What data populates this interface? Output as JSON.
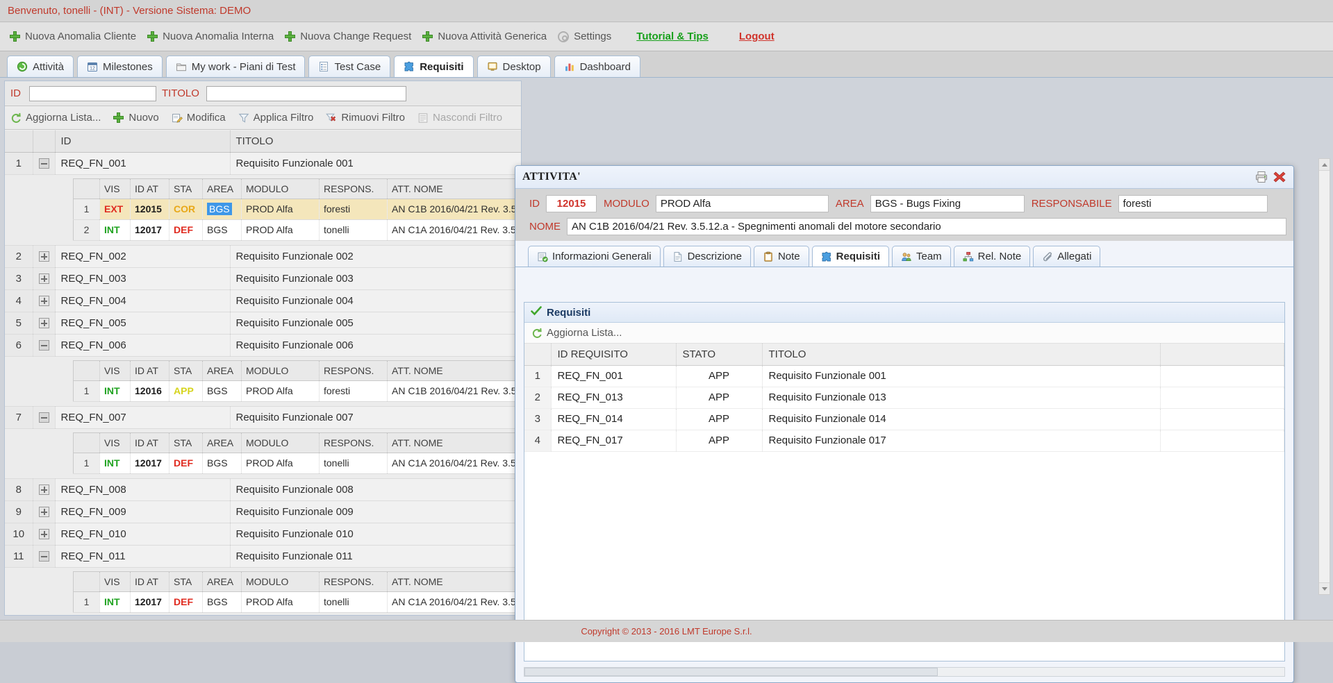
{
  "welcome": {
    "text": "Benvenuto, tonelli - (INT) - Versione Sistema: DEMO"
  },
  "action_bar": {
    "items": [
      {
        "label": "Nuova Anomalia Cliente",
        "icon": "plus-icon"
      },
      {
        "label": "Nuova Anomalia Interna",
        "icon": "plus-icon"
      },
      {
        "label": "Nuova Change Request",
        "icon": "plus-icon"
      },
      {
        "label": "Nuova Attività Generica",
        "icon": "plus-icon"
      },
      {
        "label": "Settings",
        "icon": "gear-icon"
      }
    ],
    "tutorial_label": "Tutorial & Tips",
    "logout_label": "Logout"
  },
  "main_tabs": [
    {
      "label": "Attività",
      "icon": "activity-icon",
      "active": false
    },
    {
      "label": "Milestones",
      "icon": "calendar-icon",
      "active": false
    },
    {
      "label": "My work - Piani di Test",
      "icon": "folder-icon",
      "active": false
    },
    {
      "label": "Test Case",
      "icon": "list-icon",
      "active": false
    },
    {
      "label": "Requisiti",
      "icon": "puzzle-icon",
      "active": true
    },
    {
      "label": "Desktop",
      "icon": "desktop-icon",
      "active": false
    },
    {
      "label": "Dashboard",
      "icon": "chart-icon",
      "active": false
    }
  ],
  "filter": {
    "id_label": "ID",
    "id_value": "",
    "id_placeholder": "",
    "titolo_label": "TITOLO",
    "titolo_value": "",
    "titolo_placeholder": ""
  },
  "commands": [
    {
      "label": "Aggiorna Lista...",
      "icon": "refresh-icon",
      "disabled": false
    },
    {
      "label": "Nuovo",
      "icon": "plus-icon",
      "disabled": false
    },
    {
      "label": "Modifica",
      "icon": "edit-icon",
      "disabled": false
    },
    {
      "label": "Applica Filtro",
      "icon": "funnel-icon",
      "disabled": false
    },
    {
      "label": "Rimuovi Filtro",
      "icon": "funnel-remove-icon",
      "disabled": false
    },
    {
      "label": "Nascondi Filtro",
      "icon": "hide-filter-icon",
      "disabled": true
    }
  ],
  "master_grid": {
    "headers": {
      "num": "",
      "exp": "",
      "id": "ID",
      "titolo": "TITOLO"
    },
    "sub_headers": [
      "",
      "VIS",
      "ID AT",
      "STA",
      "AREA",
      "MODULO",
      "RESPONS.",
      "ATT. NOME"
    ],
    "rows": [
      {
        "num": "1",
        "expanded": true,
        "id": "REQ_FN_001",
        "titolo": "Requisito Funzionale 001",
        "sub_rows": [
          {
            "n": "1",
            "vis": "EXT",
            "vis_kind": "ext",
            "id_at": "12015",
            "sta": "COR",
            "sta_kind": "cor",
            "area": "BGS",
            "area_highlight": true,
            "modulo": "PROD Alfa",
            "respons": "foresti",
            "att_nome": "AN C1B 2016/04/21 Rev. 3.5",
            "selected": true
          },
          {
            "n": "2",
            "vis": "INT",
            "vis_kind": "int",
            "id_at": "12017",
            "sta": "DEF",
            "sta_kind": "def",
            "area": "BGS",
            "area_highlight": false,
            "modulo": "PROD Alfa",
            "respons": "tonelli",
            "att_nome": "AN C1A 2016/04/21 Rev. 3.5",
            "selected": false
          }
        ]
      },
      {
        "num": "2",
        "expanded": false,
        "id": "REQ_FN_002",
        "titolo": "Requisito Funzionale 002",
        "sub_rows": []
      },
      {
        "num": "3",
        "expanded": false,
        "id": "REQ_FN_003",
        "titolo": "Requisito Funzionale 003",
        "sub_rows": []
      },
      {
        "num": "4",
        "expanded": false,
        "id": "REQ_FN_004",
        "titolo": "Requisito Funzionale 004",
        "sub_rows": []
      },
      {
        "num": "5",
        "expanded": false,
        "id": "REQ_FN_005",
        "titolo": "Requisito Funzionale 005",
        "sub_rows": []
      },
      {
        "num": "6",
        "expanded": true,
        "id": "REQ_FN_006",
        "titolo": "Requisito Funzionale 006",
        "sub_rows": [
          {
            "n": "1",
            "vis": "INT",
            "vis_kind": "int",
            "id_at": "12016",
            "sta": "APP",
            "sta_kind": "app",
            "area": "BGS",
            "area_highlight": false,
            "modulo": "PROD Alfa",
            "respons": "foresti",
            "att_nome": "AN C1B 2016/04/21 Rev. 3.5",
            "selected": false
          }
        ]
      },
      {
        "num": "7",
        "expanded": true,
        "id": "REQ_FN_007",
        "titolo": "Requisito Funzionale 007",
        "sub_rows": [
          {
            "n": "1",
            "vis": "INT",
            "vis_kind": "int",
            "id_at": "12017",
            "sta": "DEF",
            "sta_kind": "def",
            "area": "BGS",
            "area_highlight": false,
            "modulo": "PROD Alfa",
            "respons": "tonelli",
            "att_nome": "AN C1A 2016/04/21 Rev. 3.5",
            "selected": false
          }
        ]
      },
      {
        "num": "8",
        "expanded": false,
        "id": "REQ_FN_008",
        "titolo": "Requisito Funzionale 008",
        "sub_rows": []
      },
      {
        "num": "9",
        "expanded": false,
        "id": "REQ_FN_009",
        "titolo": "Requisito Funzionale 009",
        "sub_rows": []
      },
      {
        "num": "10",
        "expanded": false,
        "id": "REQ_FN_010",
        "titolo": "Requisito Funzionale 010",
        "sub_rows": []
      },
      {
        "num": "11",
        "expanded": true,
        "id": "REQ_FN_011",
        "titolo": "Requisito Funzionale 011",
        "sub_rows": [
          {
            "n": "1",
            "vis": "INT",
            "vis_kind": "int",
            "id_at": "12017",
            "sta": "DEF",
            "sta_kind": "def",
            "area": "BGS",
            "area_highlight": false,
            "modulo": "PROD Alfa",
            "respons": "tonelli",
            "att_nome": "AN C1A 2016/04/21 Rev. 3.5",
            "selected": false
          }
        ]
      }
    ]
  },
  "dialog": {
    "title": "ATTIVITA'",
    "print_icon": "printer-icon",
    "close_icon": "close-icon",
    "fields": {
      "id_label": "ID",
      "id_value": "12015",
      "modulo_label": "MODULO",
      "modulo_value": "PROD Alfa",
      "area_label": "AREA",
      "area_value": "BGS - Bugs Fixing",
      "responsabile_label": "RESPONSABILE",
      "responsabile_value": "foresti",
      "nome_label": "NOME",
      "nome_value": "AN C1B 2016/04/21 Rev. 3.5.12.a - Spegnimenti anomali del motore secondario"
    },
    "tabs": [
      {
        "label": "Informazioni Generali",
        "icon": "info-icon",
        "active": false
      },
      {
        "label": "Descrizione",
        "icon": "document-icon",
        "active": false
      },
      {
        "label": "Note",
        "icon": "clipboard-icon",
        "active": false
      },
      {
        "label": "Requisiti",
        "icon": "puzzle-icon",
        "active": true
      },
      {
        "label": "Team",
        "icon": "people-icon",
        "active": false
      },
      {
        "label": "Rel. Note",
        "icon": "sitemap-icon",
        "active": false
      },
      {
        "label": "Allegati",
        "icon": "paperclip-icon",
        "active": false
      }
    ],
    "section": {
      "title": "Requisiti",
      "check_icon": "checkmark-icon",
      "refresh_label": "Aggiorna Lista...",
      "refresh_icon": "refresh-icon"
    },
    "req_grid": {
      "headers": [
        "",
        "ID REQUISITO",
        "STATO",
        "TITOLO",
        ""
      ],
      "rows": [
        {
          "n": "1",
          "id": "REQ_FN_001",
          "stato": "APP",
          "titolo": "Requisito Funzionale 001"
        },
        {
          "n": "2",
          "id": "REQ_FN_013",
          "stato": "APP",
          "titolo": "Requisito Funzionale 013"
        },
        {
          "n": "3",
          "id": "REQ_FN_014",
          "stato": "APP",
          "titolo": "Requisito Funzionale 014"
        },
        {
          "n": "4",
          "id": "REQ_FN_017",
          "stato": "APP",
          "titolo": "Requisito Funzionale 017"
        }
      ]
    }
  },
  "footer": {
    "text": "Copyright © 2013 - 2016 LMT Europe S.r.l."
  },
  "colors": {
    "accent_red": "#c0392b",
    "link_green": "#17a01b",
    "link_red": "#d0342c",
    "selection_blue": "#3e97e8",
    "selected_row": "#f4e6bb",
    "status_cor": "#e8a818",
    "status_def": "#e02b20",
    "status_app": "#d6d41d",
    "vis_ext": "#e02b20",
    "vis_int": "#1fa320"
  }
}
